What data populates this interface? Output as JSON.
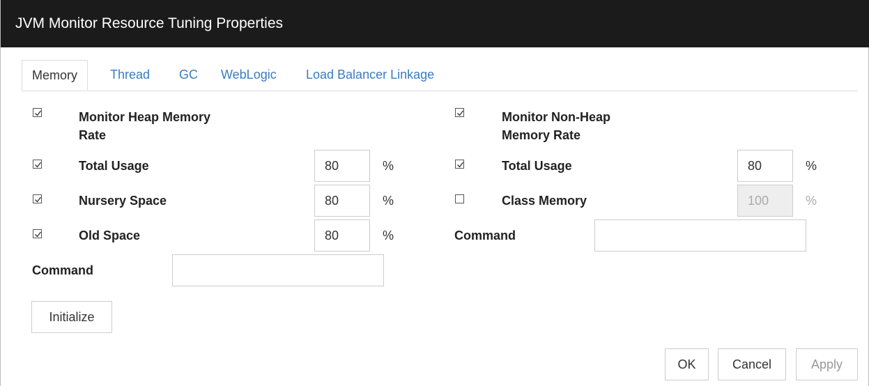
{
  "window": {
    "title": "JVM Monitor Resource Tuning Properties"
  },
  "tabs": [
    {
      "label": "Memory"
    },
    {
      "label": "Thread"
    },
    {
      "label": "GC"
    },
    {
      "label": "WebLogic"
    },
    {
      "label": "Load Balancer Linkage"
    }
  ],
  "heap": {
    "monitor_label_line1": "Monitor Heap Memory",
    "monitor_label_line2": "Rate",
    "monitor_checked": true,
    "rows": [
      {
        "label": "Total Usage",
        "checked": true,
        "value": "80",
        "unit": "%"
      },
      {
        "label": "Nursery Space",
        "checked": true,
        "value": "80",
        "unit": "%"
      },
      {
        "label": "Old Space",
        "checked": true,
        "value": "80",
        "unit": "%"
      }
    ],
    "command_label": "Command",
    "command_value": ""
  },
  "nonheap": {
    "monitor_label_line1": "Monitor Non-Heap",
    "monitor_label_line2": "Memory Rate",
    "monitor_checked": true,
    "rows": [
      {
        "label": "Total Usage",
        "checked": true,
        "value": "80",
        "unit": "%"
      },
      {
        "label": "Class Memory",
        "checked": false,
        "value": "100",
        "unit": "%"
      }
    ],
    "command_label": "Command",
    "command_value": ""
  },
  "buttons": {
    "initialize": "Initialize",
    "ok": "OK",
    "cancel": "Cancel",
    "apply": "Apply"
  }
}
